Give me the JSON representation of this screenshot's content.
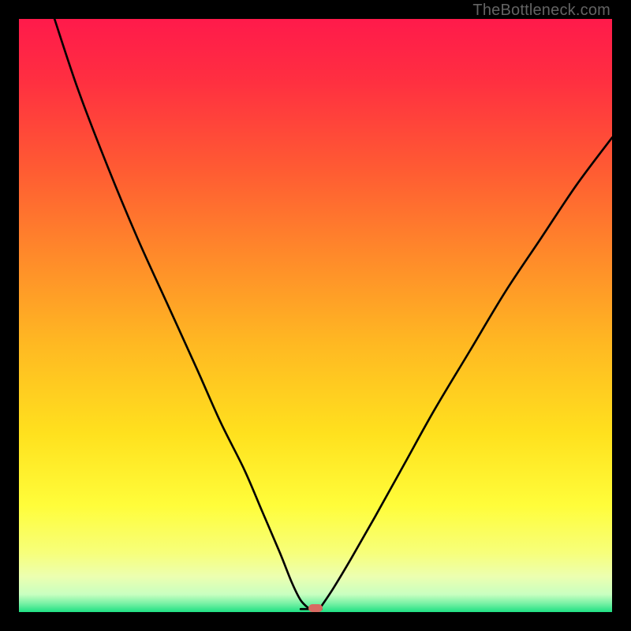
{
  "watermark": {
    "text": "TheBottleneck.com"
  },
  "colors": {
    "black": "#000000",
    "marker": "#d86a62",
    "gradient_stops": [
      {
        "offset": 0.0,
        "color": "#ff1a4b"
      },
      {
        "offset": 0.1,
        "color": "#ff2e41"
      },
      {
        "offset": 0.25,
        "color": "#ff5a33"
      },
      {
        "offset": 0.4,
        "color": "#ff8a2a"
      },
      {
        "offset": 0.55,
        "color": "#ffb922"
      },
      {
        "offset": 0.7,
        "color": "#ffe11e"
      },
      {
        "offset": 0.82,
        "color": "#fffd3a"
      },
      {
        "offset": 0.9,
        "color": "#f7ff7a"
      },
      {
        "offset": 0.94,
        "color": "#ecffb0"
      },
      {
        "offset": 0.97,
        "color": "#c9ffc0"
      },
      {
        "offset": 0.985,
        "color": "#7af2a6"
      },
      {
        "offset": 1.0,
        "color": "#1fe083"
      }
    ]
  },
  "chart_data": {
    "type": "line",
    "title": "",
    "xlabel": "",
    "ylabel": "",
    "xlim": [
      0,
      100
    ],
    "ylim": [
      0,
      100
    ],
    "grid": false,
    "note": "Values estimated from pixel positions; abstract V-shaped bottleneck curve with minimum near x≈49.",
    "series": [
      {
        "name": "left-branch",
        "x": [
          6,
          10,
          15,
          20,
          25,
          30,
          34,
          38,
          41,
          44,
          46,
          47.5,
          49
        ],
        "y": [
          100,
          88,
          75,
          63,
          52,
          41,
          32,
          24,
          17,
          10,
          5,
          2,
          0.5
        ]
      },
      {
        "name": "right-branch",
        "x": [
          51,
          53,
          56,
          60,
          65,
          70,
          76,
          82,
          88,
          94,
          100
        ],
        "y": [
          1,
          4,
          9,
          16,
          25,
          34,
          44,
          54,
          63,
          72,
          80
        ]
      },
      {
        "name": "floor",
        "x": [
          47.5,
          51
        ],
        "y": [
          0.5,
          0.5
        ]
      }
    ],
    "marker": {
      "x": 50,
      "y": 0.6
    }
  }
}
